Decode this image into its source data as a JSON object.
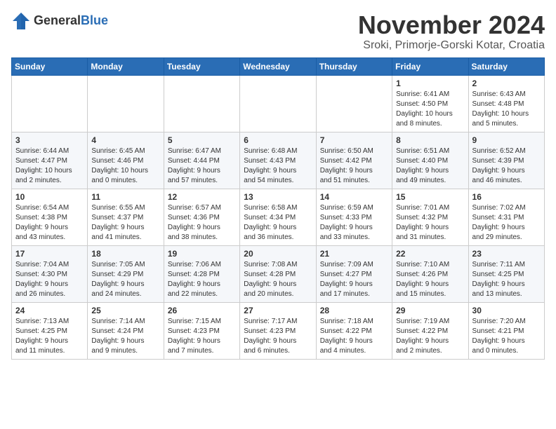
{
  "logo": {
    "general": "General",
    "blue": "Blue"
  },
  "title": "November 2024",
  "location": "Sroki, Primorje-Gorski Kotar, Croatia",
  "headers": [
    "Sunday",
    "Monday",
    "Tuesday",
    "Wednesday",
    "Thursday",
    "Friday",
    "Saturday"
  ],
  "weeks": [
    [
      {
        "day": "",
        "info": ""
      },
      {
        "day": "",
        "info": ""
      },
      {
        "day": "",
        "info": ""
      },
      {
        "day": "",
        "info": ""
      },
      {
        "day": "",
        "info": ""
      },
      {
        "day": "1",
        "info": "Sunrise: 6:41 AM\nSunset: 4:50 PM\nDaylight: 10 hours\nand 8 minutes."
      },
      {
        "day": "2",
        "info": "Sunrise: 6:43 AM\nSunset: 4:48 PM\nDaylight: 10 hours\nand 5 minutes."
      }
    ],
    [
      {
        "day": "3",
        "info": "Sunrise: 6:44 AM\nSunset: 4:47 PM\nDaylight: 10 hours\nand 2 minutes."
      },
      {
        "day": "4",
        "info": "Sunrise: 6:45 AM\nSunset: 4:46 PM\nDaylight: 10 hours\nand 0 minutes."
      },
      {
        "day": "5",
        "info": "Sunrise: 6:47 AM\nSunset: 4:44 PM\nDaylight: 9 hours\nand 57 minutes."
      },
      {
        "day": "6",
        "info": "Sunrise: 6:48 AM\nSunset: 4:43 PM\nDaylight: 9 hours\nand 54 minutes."
      },
      {
        "day": "7",
        "info": "Sunrise: 6:50 AM\nSunset: 4:42 PM\nDaylight: 9 hours\nand 51 minutes."
      },
      {
        "day": "8",
        "info": "Sunrise: 6:51 AM\nSunset: 4:40 PM\nDaylight: 9 hours\nand 49 minutes."
      },
      {
        "day": "9",
        "info": "Sunrise: 6:52 AM\nSunset: 4:39 PM\nDaylight: 9 hours\nand 46 minutes."
      }
    ],
    [
      {
        "day": "10",
        "info": "Sunrise: 6:54 AM\nSunset: 4:38 PM\nDaylight: 9 hours\nand 43 minutes."
      },
      {
        "day": "11",
        "info": "Sunrise: 6:55 AM\nSunset: 4:37 PM\nDaylight: 9 hours\nand 41 minutes."
      },
      {
        "day": "12",
        "info": "Sunrise: 6:57 AM\nSunset: 4:36 PM\nDaylight: 9 hours\nand 38 minutes."
      },
      {
        "day": "13",
        "info": "Sunrise: 6:58 AM\nSunset: 4:34 PM\nDaylight: 9 hours\nand 36 minutes."
      },
      {
        "day": "14",
        "info": "Sunrise: 6:59 AM\nSunset: 4:33 PM\nDaylight: 9 hours\nand 33 minutes."
      },
      {
        "day": "15",
        "info": "Sunrise: 7:01 AM\nSunset: 4:32 PM\nDaylight: 9 hours\nand 31 minutes."
      },
      {
        "day": "16",
        "info": "Sunrise: 7:02 AM\nSunset: 4:31 PM\nDaylight: 9 hours\nand 29 minutes."
      }
    ],
    [
      {
        "day": "17",
        "info": "Sunrise: 7:04 AM\nSunset: 4:30 PM\nDaylight: 9 hours\nand 26 minutes."
      },
      {
        "day": "18",
        "info": "Sunrise: 7:05 AM\nSunset: 4:29 PM\nDaylight: 9 hours\nand 24 minutes."
      },
      {
        "day": "19",
        "info": "Sunrise: 7:06 AM\nSunset: 4:28 PM\nDaylight: 9 hours\nand 22 minutes."
      },
      {
        "day": "20",
        "info": "Sunrise: 7:08 AM\nSunset: 4:28 PM\nDaylight: 9 hours\nand 20 minutes."
      },
      {
        "day": "21",
        "info": "Sunrise: 7:09 AM\nSunset: 4:27 PM\nDaylight: 9 hours\nand 17 minutes."
      },
      {
        "day": "22",
        "info": "Sunrise: 7:10 AM\nSunset: 4:26 PM\nDaylight: 9 hours\nand 15 minutes."
      },
      {
        "day": "23",
        "info": "Sunrise: 7:11 AM\nSunset: 4:25 PM\nDaylight: 9 hours\nand 13 minutes."
      }
    ],
    [
      {
        "day": "24",
        "info": "Sunrise: 7:13 AM\nSunset: 4:25 PM\nDaylight: 9 hours\nand 11 minutes."
      },
      {
        "day": "25",
        "info": "Sunrise: 7:14 AM\nSunset: 4:24 PM\nDaylight: 9 hours\nand 9 minutes."
      },
      {
        "day": "26",
        "info": "Sunrise: 7:15 AM\nSunset: 4:23 PM\nDaylight: 9 hours\nand 7 minutes."
      },
      {
        "day": "27",
        "info": "Sunrise: 7:17 AM\nSunset: 4:23 PM\nDaylight: 9 hours\nand 6 minutes."
      },
      {
        "day": "28",
        "info": "Sunrise: 7:18 AM\nSunset: 4:22 PM\nDaylight: 9 hours\nand 4 minutes."
      },
      {
        "day": "29",
        "info": "Sunrise: 7:19 AM\nSunset: 4:22 PM\nDaylight: 9 hours\nand 2 minutes."
      },
      {
        "day": "30",
        "info": "Sunrise: 7:20 AM\nSunset: 4:21 PM\nDaylight: 9 hours\nand 0 minutes."
      }
    ]
  ]
}
